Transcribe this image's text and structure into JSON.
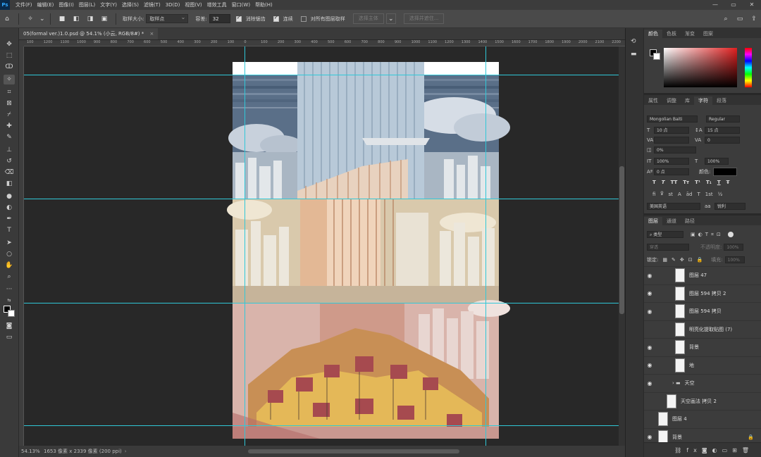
{
  "app": {
    "logo": "Ps"
  },
  "menu": [
    "文件(F)",
    "编辑(E)",
    "图像(I)",
    "图层(L)",
    "文字(Y)",
    "选择(S)",
    "滤镜(T)",
    "3D(D)",
    "视图(V)",
    "增效工具",
    "窗口(W)",
    "帮助(H)"
  ],
  "window_controls": [
    "—",
    "▭",
    "✕"
  ],
  "options": {
    "sample_size_label": "取样大小:",
    "sample_size_value": "取样点",
    "tolerance_label": "容差:",
    "tolerance_value": "32",
    "antialias_label": "消除锯齿",
    "antialias_checked": true,
    "contiguous_label": "连续",
    "contiguous_checked": true,
    "sample_all_label": "对所有图层取样",
    "sample_all_checked": false,
    "select_subject_label": "选择主体",
    "select_and_mask_label": "选择并遮住..."
  },
  "document": {
    "tab_title": "05(formal ver.)1.0.psd @ 54.1% (小云, RGB/8#) *",
    "zoom": "54.13%",
    "dimensions": "1653 像素 x 2339 像素 (200 ppi)"
  },
  "ruler_h_labels": [
    "100",
    "1200",
    "1100",
    "1000",
    "900",
    "800",
    "700",
    "600",
    "500",
    "400",
    "300",
    "200",
    "100",
    "0",
    "100",
    "200",
    "300",
    "400",
    "500",
    "600",
    "700",
    "800",
    "900",
    "1000",
    "1100",
    "1200",
    "1300",
    "1400",
    "1500",
    "1600",
    "1700",
    "1800",
    "1900",
    "2000",
    "2100",
    "2200"
  ],
  "color_panel": {
    "tabs": [
      "颜色",
      "色板",
      "渐变",
      "图案"
    ]
  },
  "char_panel": {
    "tabs": [
      "属性",
      "调整",
      "库",
      "字符",
      "段落"
    ],
    "active_tab": "字符",
    "font_family": "Mongolian Baiti",
    "font_style": "Regular",
    "font_size": "10 点",
    "leading": "15 点",
    "kerning": "",
    "tracking": "0",
    "tsume": "0%",
    "vscale": "100%",
    "hscale": "100%",
    "baseline": "0 点",
    "color_label": "颜色:",
    "style_buttons": [
      "T",
      "T",
      "TT",
      "Tт",
      "T¹",
      "T₁",
      "T",
      "Ŧ"
    ],
    "ot_buttons": [
      "fi",
      "ꝿ",
      "st",
      "A",
      "ād",
      "T",
      "1st",
      "½"
    ],
    "language": "美国英语",
    "aa": "锐利"
  },
  "layers_panel": {
    "tabs": [
      "图层",
      "通道",
      "路径"
    ],
    "filter_label": "类型",
    "blend_mode": "穿透",
    "opacity_label": "不透明度:",
    "opacity_value": "100%",
    "lock_label": "锁定:",
    "fill_label": "填充:",
    "fill_value": "100%",
    "layers": [
      {
        "name": "图层 47",
        "visible": true,
        "indent": 2
      },
      {
        "name": "图层 594 拷贝 2",
        "visible": true,
        "indent": 2
      },
      {
        "name": "图层 594 拷贝",
        "visible": true,
        "indent": 2
      },
      {
        "name": "明亮化提取贴图 (7)",
        "visible": false,
        "indent": 2
      },
      {
        "name": "背景",
        "visible": true,
        "indent": 2
      },
      {
        "name": "地",
        "visible": true,
        "indent": 2
      },
      {
        "name": "天空",
        "visible": true,
        "indent": 1,
        "group": true
      },
      {
        "name": "天空画法 拷贝 2",
        "visible": false,
        "indent": 1
      },
      {
        "name": "图层 4",
        "visible": false,
        "indent": 0
      },
      {
        "name": "背景",
        "visible": true,
        "indent": 0,
        "locked": true
      }
    ]
  }
}
